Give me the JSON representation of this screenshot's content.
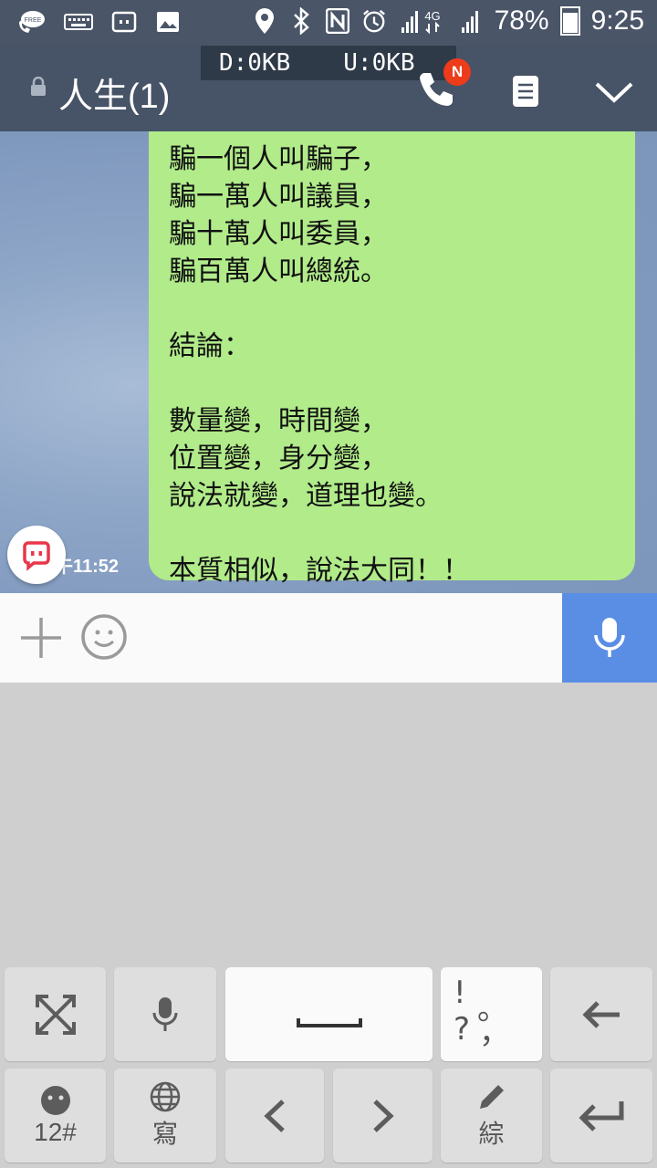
{
  "status_bar": {
    "battery_percent": "78%",
    "time": "9:25",
    "free_badge": "FREE",
    "network_label": "4G",
    "nfc_label": "N"
  },
  "speed_overlay": {
    "download": "D:0KB",
    "upload": "U:0KB"
  },
  "header": {
    "title": "人生(1)",
    "notification_badge": "N"
  },
  "message": {
    "lines": [
      "騙一個人叫騙子，",
      "騙一萬人叫議員，",
      "騙十萬人叫委員，",
      "騙百萬人叫總統。",
      "",
      "結論：",
      "",
      "數量變，時間變，",
      "位置變，身分變，",
      "說法就變，道理也變。",
      "",
      "本質相似，說法大同！！"
    ],
    "time": "午11:52"
  },
  "input": {
    "placeholder": "",
    "value": ""
  },
  "keyboard": {
    "numbers_label": "12#",
    "writing_label": "寫",
    "mode_label": "綜",
    "punct_top": "! ?",
    "punct_mid": "。",
    "punct_bottom": "，"
  },
  "colors": {
    "header_bg": "#475366",
    "bubble_bg": "#b1eb8a",
    "mic_bg": "#5a8ee4",
    "badge_red": "#ee3b1a"
  },
  "icons": [
    "phone-free-icon",
    "keyboard-icon",
    "line-app-icon",
    "image-icon",
    "location-icon",
    "bluetooth-icon",
    "nfc-icon",
    "alarm-icon",
    "signal-icon",
    "battery-icon",
    "lock-icon",
    "phone-icon",
    "notes-icon",
    "chevron-down-icon",
    "plus-icon",
    "emoji-icon",
    "microphone-icon",
    "fullscreen-icon",
    "smiley-icon",
    "globe-icon",
    "arrow-left-icon",
    "arrow-right-icon",
    "pencil-icon",
    "backspace-icon",
    "enter-icon"
  ]
}
